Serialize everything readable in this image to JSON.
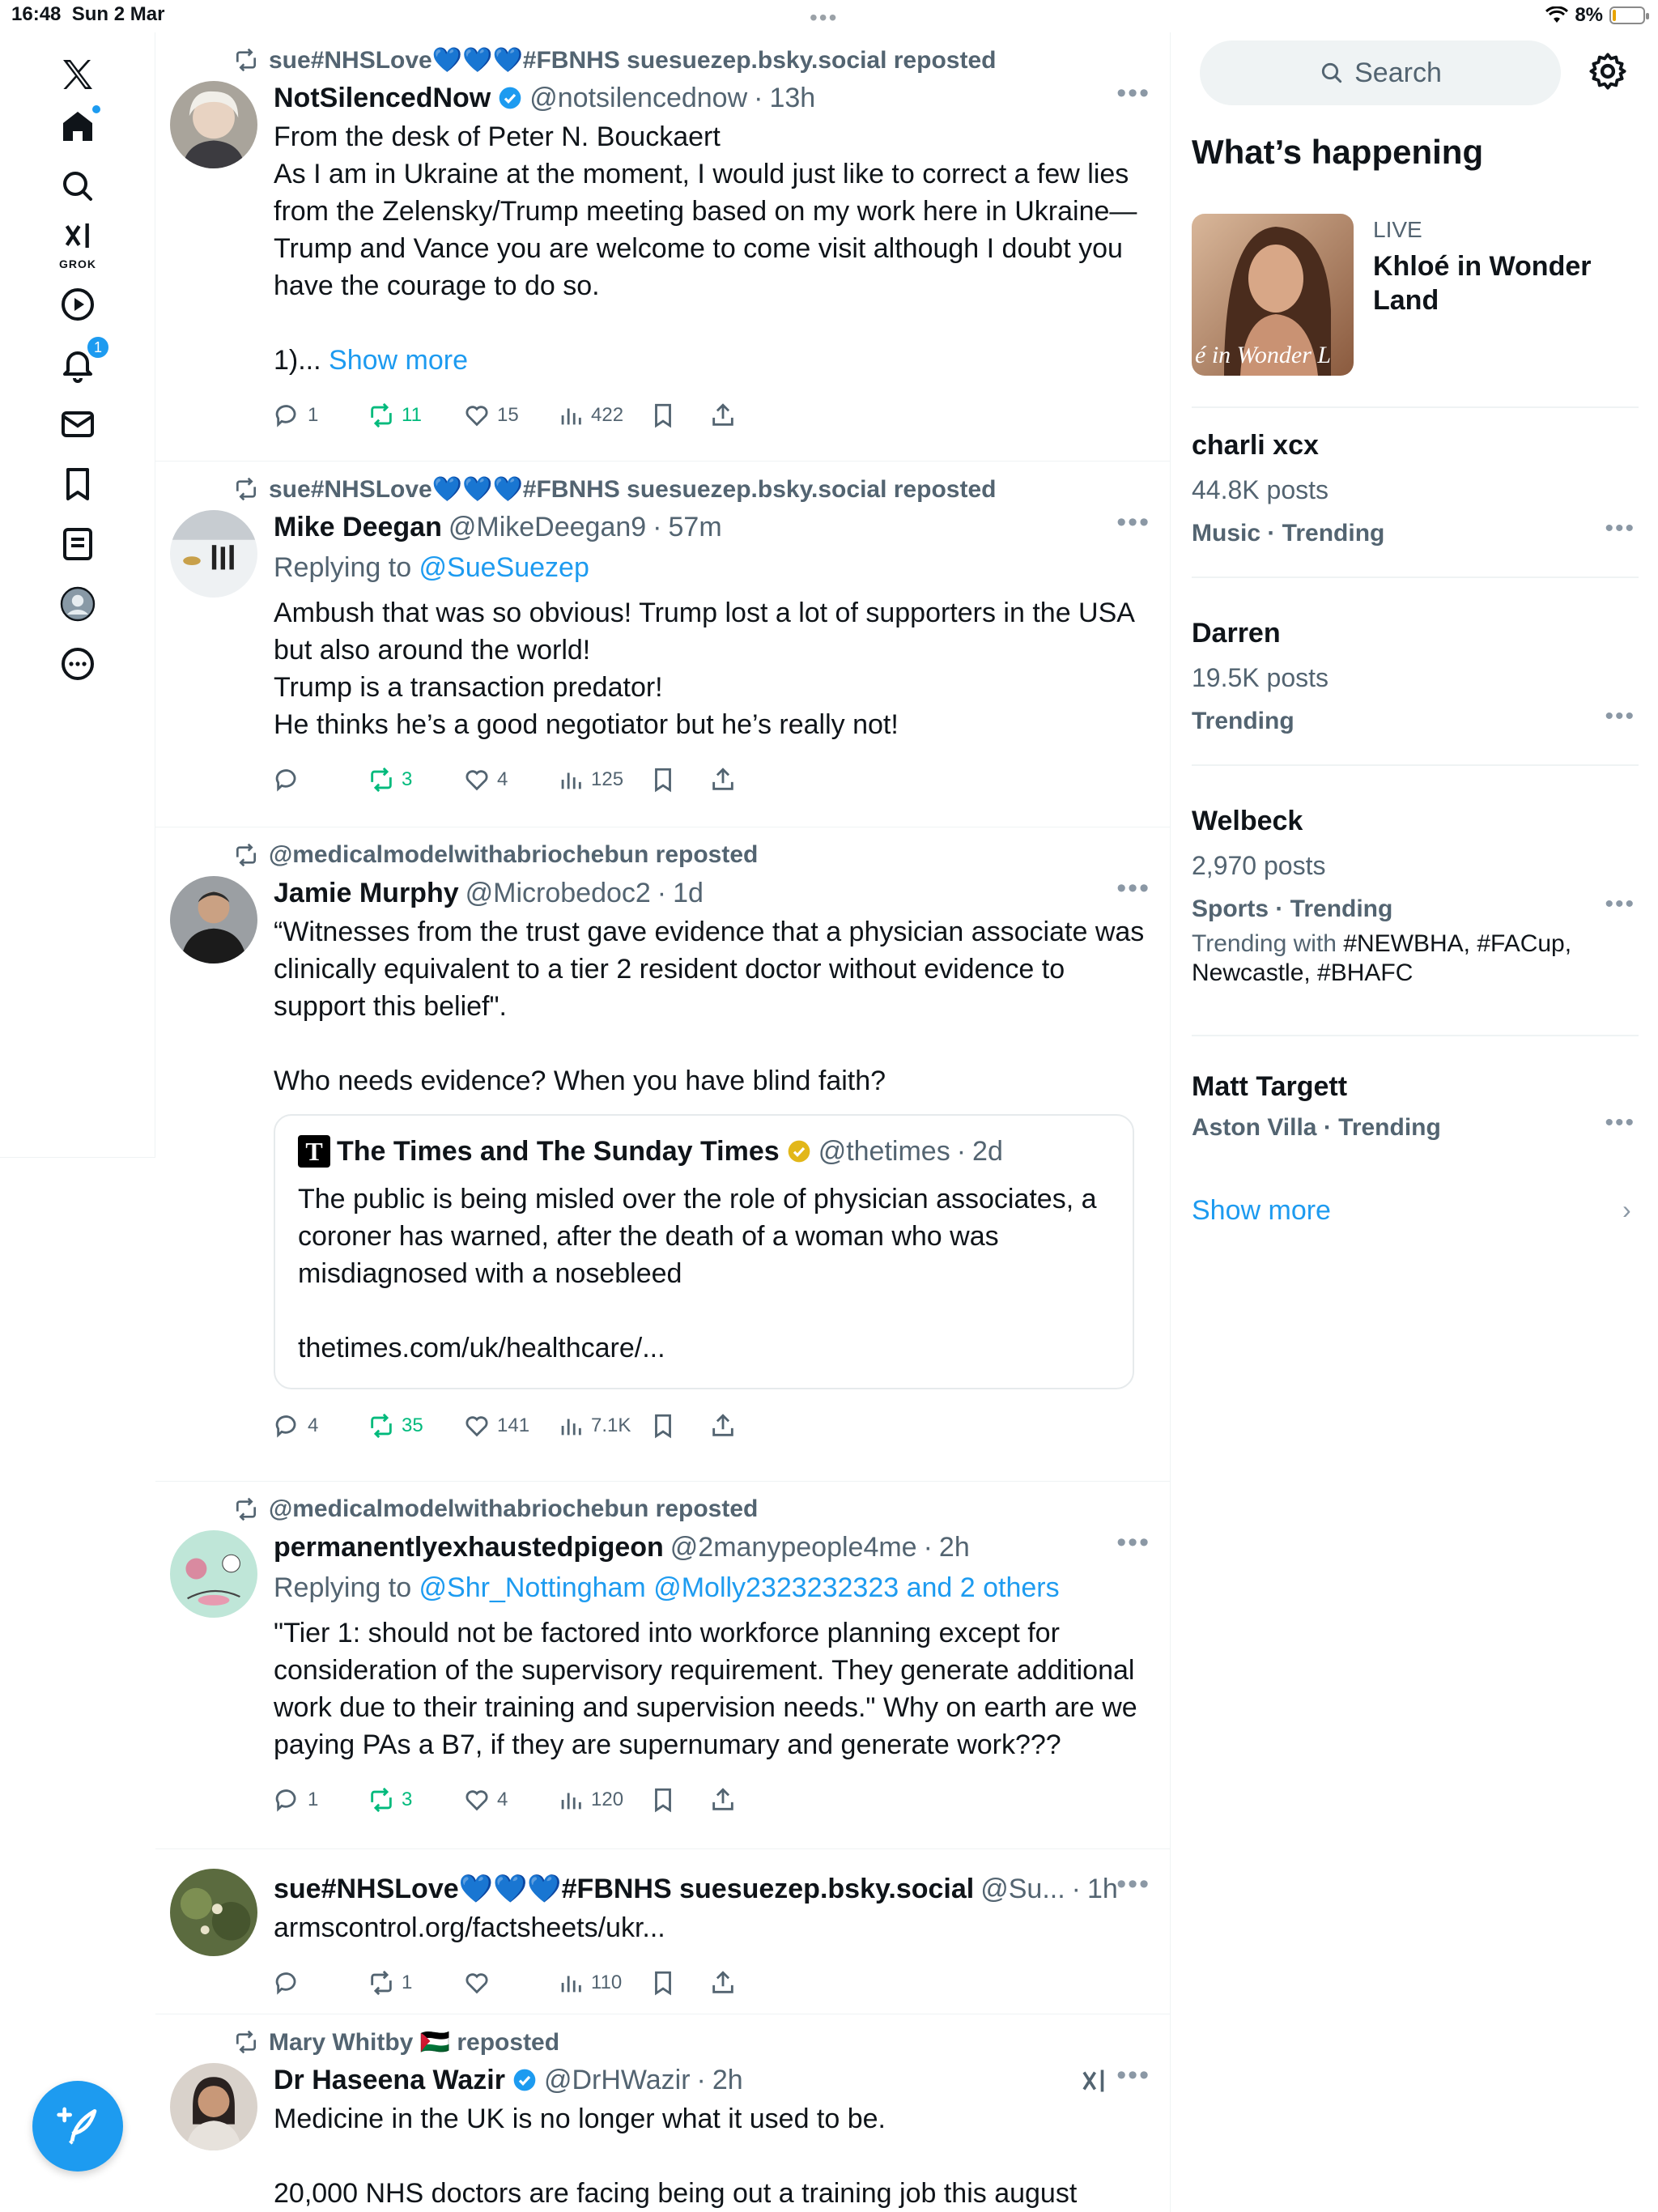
{
  "status": {
    "time": "16:48",
    "date": "Sun 2 Mar",
    "grabber": "•••",
    "battery": "8%"
  },
  "nav": {
    "grok_label": "GROK",
    "notifications_badge": "1",
    "items": [
      "home-icon",
      "search-icon",
      "grok-icon",
      "video-icon",
      "bell-icon",
      "mail-icon",
      "bookmark-icon",
      "lists-icon",
      "profile-icon",
      "more-icon"
    ]
  },
  "compose": {
    "icon": "feather-plus-icon"
  },
  "posts": [
    {
      "repost_by": "sue#NHSLove💙💙💙#FBNHS suesuezep.bsky.social reposted",
      "name": "NotSilencedNow",
      "verified": true,
      "handle": "@notsilencednow",
      "time": "13h",
      "text": "From the desk of Peter N. Bouckaert\nAs I am in Ukraine at the moment, I would just like to correct a few lies from the Zelensky/Trump meeting based on my work here in Ukraine— Trump and Vance you are welcome to come visit although I doubt you have the courage to do so.\n\n1)... ",
      "show_more": "Show more",
      "replies": "1",
      "reposts": "11",
      "likes": "15",
      "views": "422"
    },
    {
      "repost_by": "sue#NHSLove💙💙💙#FBNHS suesuezep.bsky.social reposted",
      "name": "Mike Deegan",
      "handle": "@MikeDeegan9",
      "time": "57m",
      "reply_prefix": "Replying to ",
      "reply_to": "@SueSuezep",
      "text": "Ambush that was so obvious! Trump lost a lot of supporters in the USA but also around the world!\nTrump is a transaction predator!\nHe thinks he’s a good negotiator but he’s really not!",
      "replies": "",
      "reposts": "3",
      "likes": "4",
      "views": "125"
    },
    {
      "repost_by": "@medicalmodelwithabriochebun reposted",
      "name": "Jamie Murphy",
      "handle": "@Microbedoc2",
      "time": "1d",
      "text": "“Witnesses from the trust gave evidence that a physician associate was clinically equivalent to a tier 2 resident doctor without evidence to support this belief\".\n\nWho needs evidence? When you have blind faith?",
      "quote": {
        "logo": "T",
        "name": "The Times and The Sunday Times",
        "handle": "@thetimes",
        "time": "2d",
        "text": "The public is being misled over the role of physician associates, a coroner has warned, after the death of a woman who was misdiagnosed with a nosebleed\n\nthetimes.com/uk/healthcare/..."
      },
      "replies": "4",
      "reposts": "35",
      "likes": "141",
      "views": "7.1K"
    },
    {
      "repost_by": "@medicalmodelwithabriochebun reposted",
      "name": "permanentlyexhaustedpigeon",
      "handle": "@2manypeople4me",
      "time": "2h",
      "reply_prefix": "Replying to ",
      "reply_to": "@Shr_Nottingham @Molly2323232323 and 2 others",
      "text": "\"Tier 1: should not be factored into workforce planning except for consideration of the supervisory requirement. They generate additional work due to their training and supervision needs.\" Why on earth are we paying PAs a B7, if they are supernumary and generate work???",
      "replies": "1",
      "reposts": "3",
      "likes": "4",
      "views": "120"
    },
    {
      "name": "sue#NHSLove💙💙💙#FBNHS suesuezep.bsky.social",
      "handle": "@Su...",
      "time": "1h",
      "link": "armscontrol.org/factsheets/ukr...",
      "replies": "",
      "reposts": "1",
      "likes": "",
      "views": "110"
    },
    {
      "repost_by": "Mary Whitby 🇵🇸 reposted",
      "name": "Dr Haseena Wazir",
      "verified": true,
      "handle": "@DrHWazir",
      "time": "2h",
      "text": "Medicine in the UK is no longer what it used to be.\n\n20,000 NHS doctors are facing being out a training job this august"
    }
  ],
  "sidebar": {
    "search_placeholder": "Search",
    "title": "What’s happening",
    "live": {
      "tag": "LIVE",
      "title": "Khloé in Wonder Land",
      "image_text": "é in Wonder L"
    },
    "trends": [
      {
        "name": "charli xcx",
        "posts": "44.8K posts",
        "category": "Music · Trending"
      },
      {
        "name": "Darren",
        "posts": "19.5K posts",
        "category": "Trending"
      },
      {
        "name": "Welbeck",
        "posts": "2,970 posts",
        "category": "Sports · Trending",
        "with_label": "Trending with ",
        "with_tags": "#NEWBHA, #FACup, Newcastle, #BHAFC"
      },
      {
        "name": "Matt Targett",
        "category": "Aston Villa · Trending"
      }
    ],
    "show_more": "Show more"
  },
  "colors": {
    "accent": "#1d9bf0",
    "repost": "#00ba7c",
    "muted": "#536471"
  }
}
